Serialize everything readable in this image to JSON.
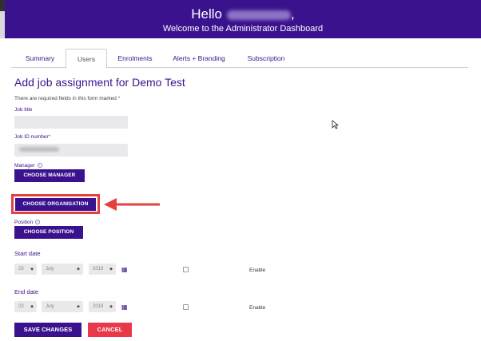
{
  "header": {
    "greeting": "Hello",
    "subtitle": "Welcome to the Administrator Dashboard"
  },
  "tabs": [
    {
      "label": "Summary",
      "active": false
    },
    {
      "label": "Users",
      "active": true
    },
    {
      "label": "Enrolments",
      "active": false
    },
    {
      "label": "Alerts + Branding",
      "active": false
    },
    {
      "label": "Subscription",
      "active": false
    }
  ],
  "form": {
    "title": "Add job assignment for Demo Test",
    "required_note": "There are required fields in this form marked",
    "required_star": "*",
    "job_title_label": "Job title",
    "job_id_label": "Job ID number",
    "manager_label": "Manager",
    "choose_manager": "CHOOSE MANAGER",
    "choose_organisation": "CHOOSE ORGANISATION",
    "position_label": "Position",
    "choose_position": "CHOOSE POSITION",
    "start_date_label": "Start date",
    "end_date_label": "End date",
    "start_day": "23",
    "start_month": "July",
    "start_year": "2019",
    "end_day": "23",
    "end_month": "July",
    "end_year": "2019",
    "enable_label": "Enable",
    "save_button": "SAVE CHANGES",
    "cancel_button": "CANCEL"
  },
  "colors": {
    "brand": "#3b128d",
    "cancel": "#e8384a",
    "highlight": "#e3403f"
  }
}
